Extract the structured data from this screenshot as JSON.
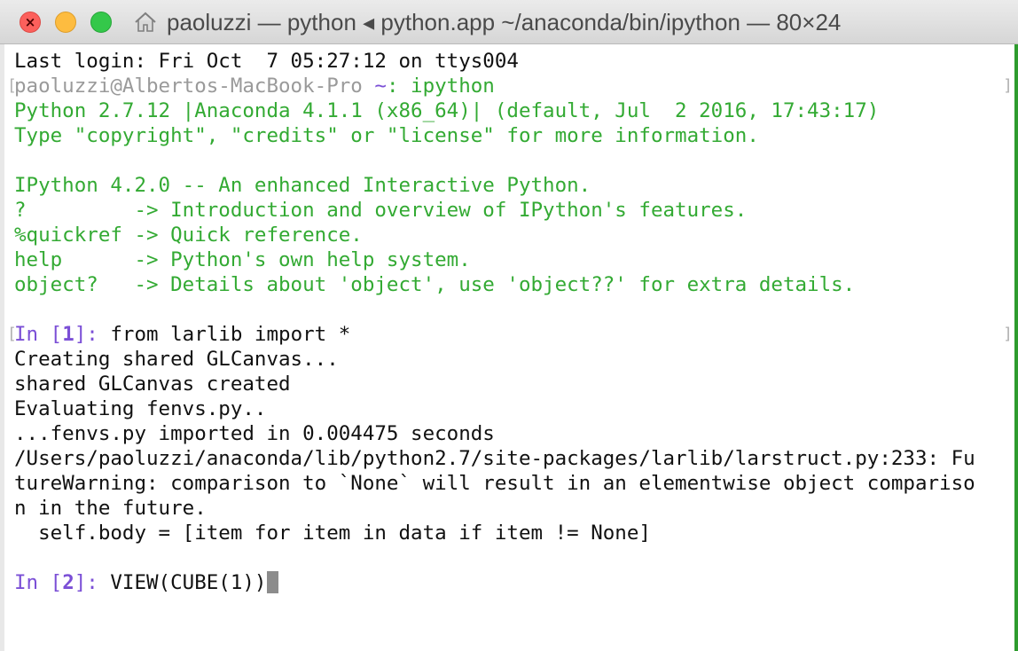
{
  "window": {
    "title": "paoluzzi — python ◂ python.app ~/anaconda/bin/ipython — 80×24"
  },
  "terminal": {
    "last_login": "Last login: Fri Oct  7 05:27:12 on ttys004",
    "prompt_user": "paoluzzi@Albertos-MacBook-Pro",
    "prompt_dir": "~",
    "prompt_cmd": ": ipython",
    "banner": [
      "Python 2.7.12 |Anaconda 4.1.1 (x86_64)| (default, Jul  2 2016, 17:43:17)",
      "Type \"copyright\", \"credits\" or \"license\" for more information.",
      "",
      "IPython 4.2.0 -- An enhanced Interactive Python.",
      "?         -> Introduction and overview of IPython's features.",
      "%quickref -> Quick reference.",
      "help      -> Python's own help system.",
      "object?   -> Details about 'object', use 'object??' for extra details."
    ],
    "in1_prefix": "In [",
    "in1_num": "1",
    "in1_suffix": "]: ",
    "in1_code": "from larlib import *",
    "output": [
      "Creating shared GLCanvas...",
      "shared GLCanvas created",
      "Evaluating fenvs.py..",
      "...fenvs.py imported in 0.004475 seconds",
      "/Users/paoluzzi/anaconda/lib/python2.7/site-packages/larlib/larstruct.py:233: Fu",
      "tureWarning: comparison to `None` will result in an elementwise object compariso",
      "n in the future.",
      "  self.body = [item for item in data if item != None]"
    ],
    "in2_prefix": "In [",
    "in2_num": "2",
    "in2_suffix": "]: ",
    "in2_code": "VIEW(CUBE(1))"
  },
  "colors": {
    "banner_green": "#33aa33",
    "prompt_purple": "#7b4fd6",
    "close": "#fc605c",
    "minimize": "#fdbc40",
    "maximize": "#34c84a"
  }
}
